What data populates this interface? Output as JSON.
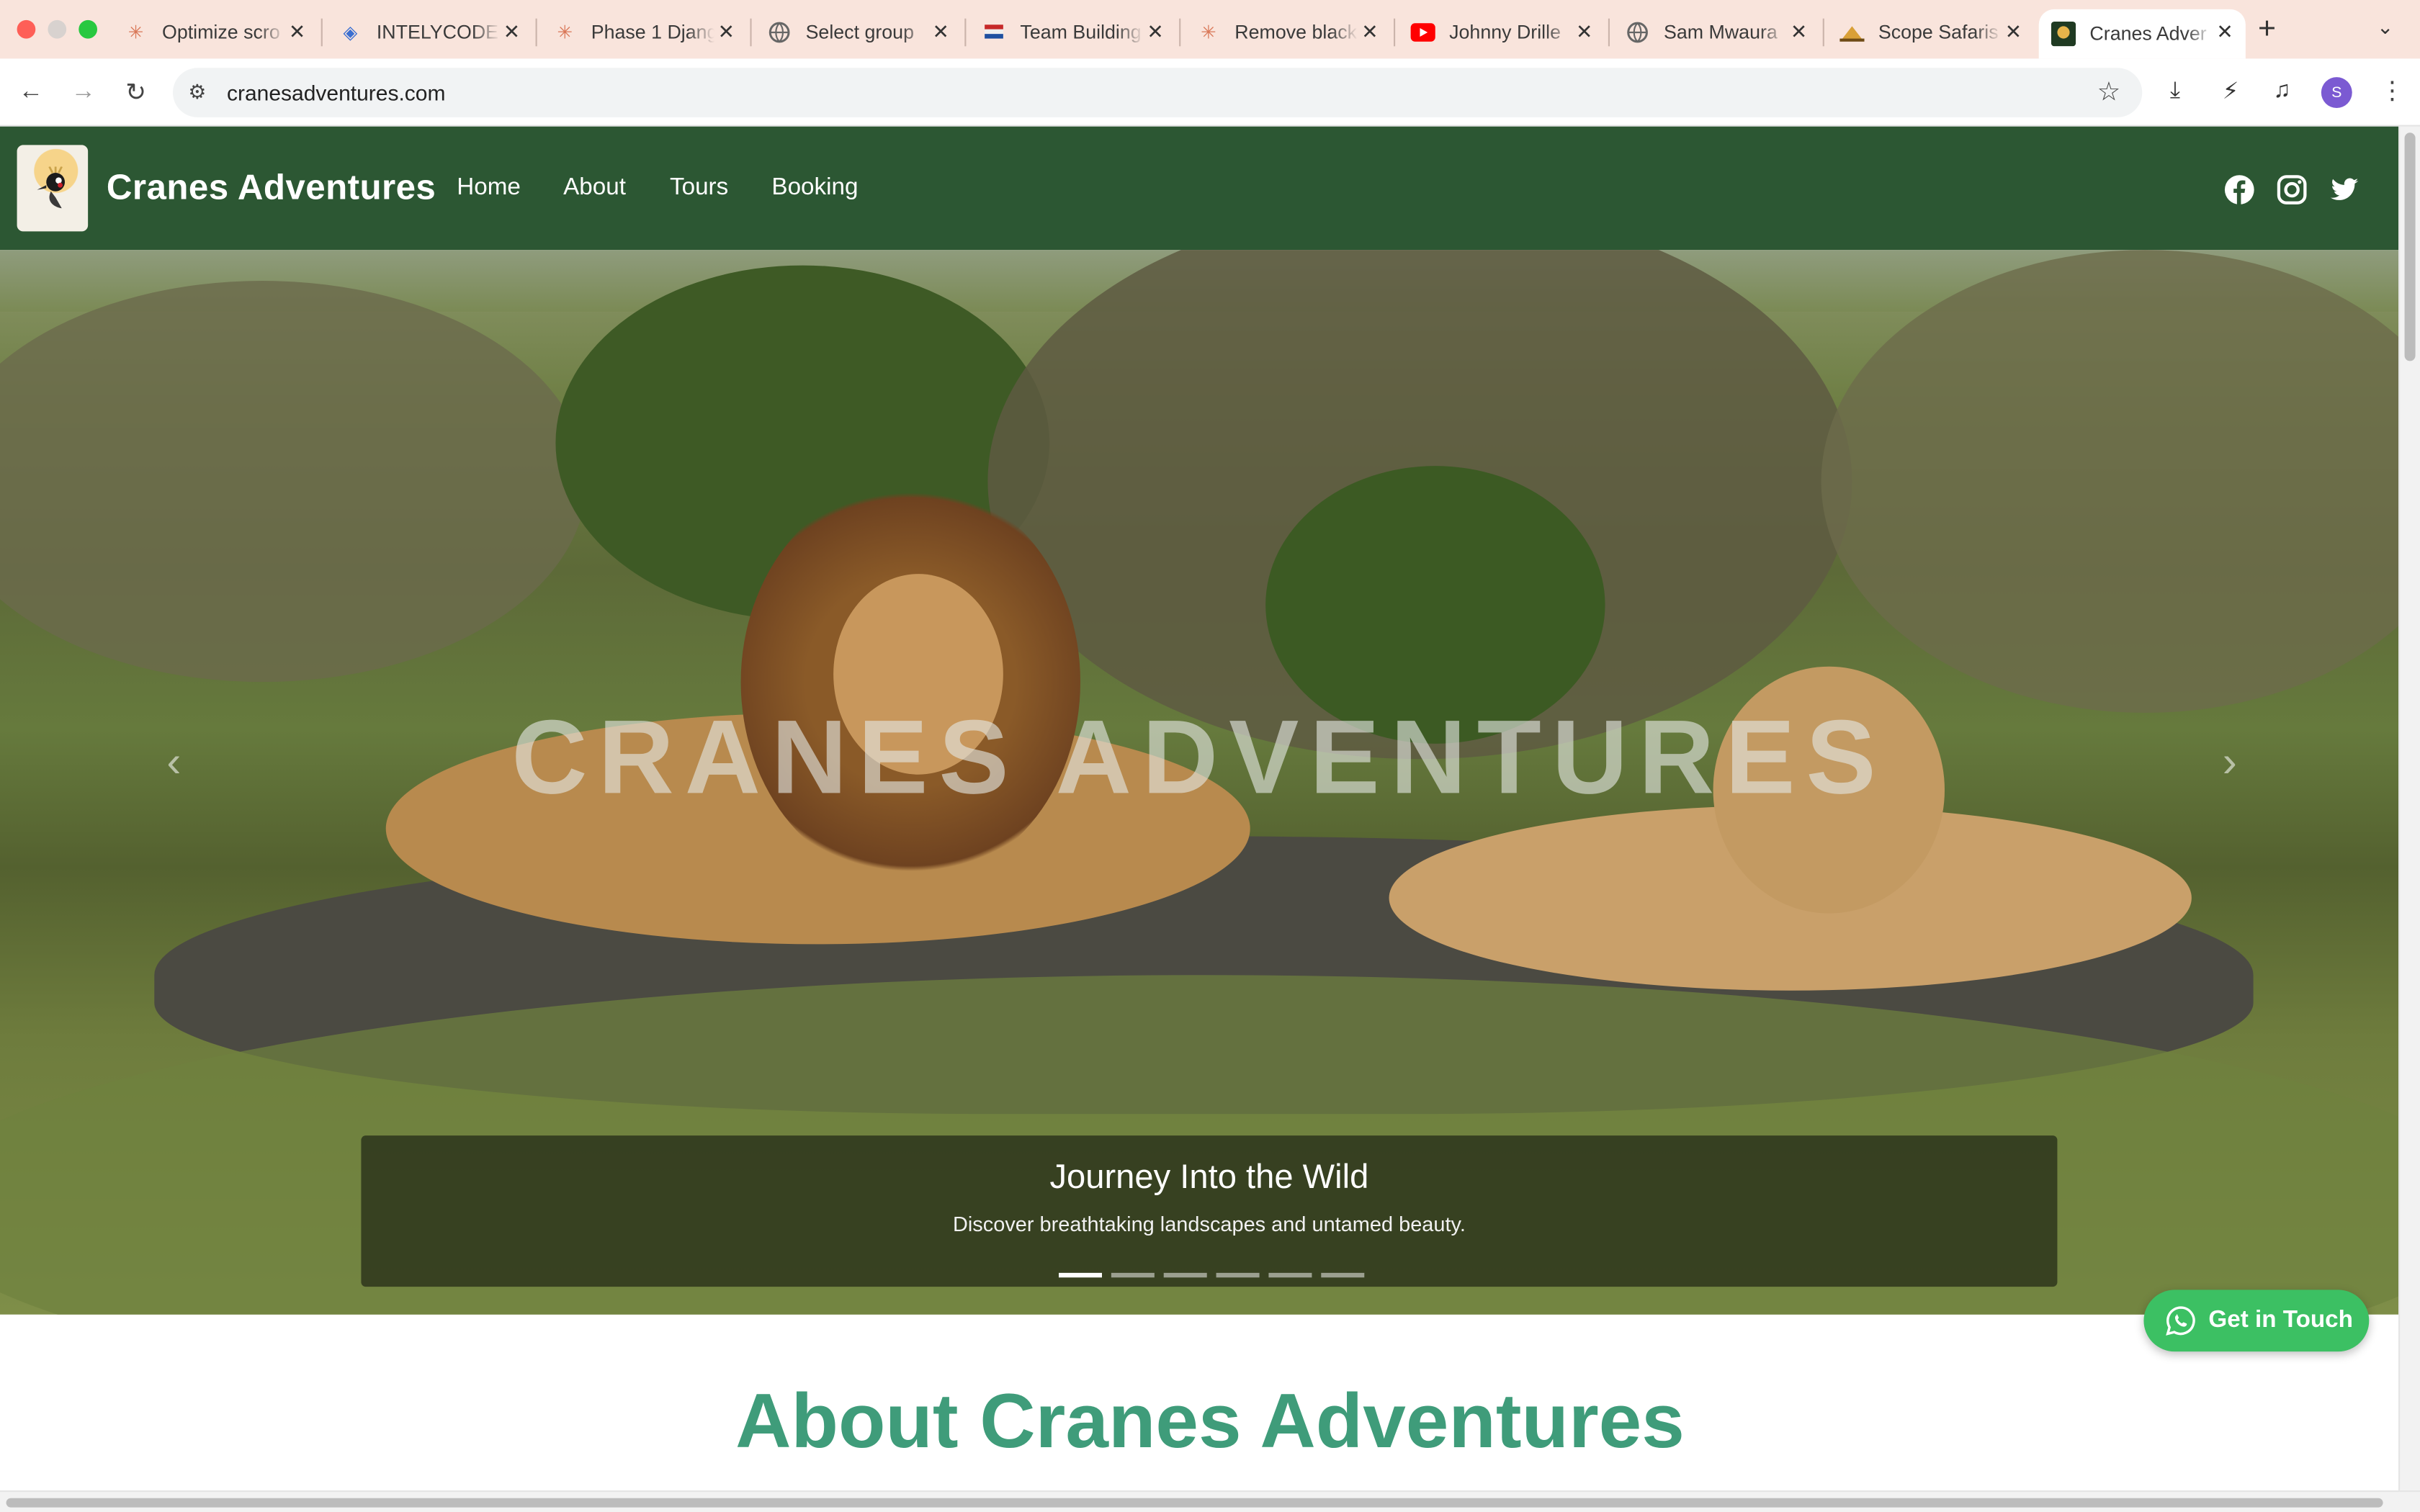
{
  "browser": {
    "tabs": [
      {
        "title": "Optimize scro",
        "icon": "claude-starburst-icon"
      },
      {
        "title": "INTELYCODE",
        "icon": "intelycode-icon"
      },
      {
        "title": "Phase 1 Djang",
        "icon": "claude-starburst-icon"
      },
      {
        "title": "Select group",
        "icon": "globe-icon"
      },
      {
        "title": "Team Building",
        "icon": "flag-icon"
      },
      {
        "title": "Remove black",
        "icon": "claude-starburst-icon"
      },
      {
        "title": "Johnny Drille",
        "icon": "youtube-icon"
      },
      {
        "title": "Sam Mwaura",
        "icon": "globe-icon"
      },
      {
        "title": "Scope Safaris",
        "icon": "safari-logo-icon"
      },
      {
        "title": "Cranes Adver",
        "icon": "cranes-logo-icon",
        "active": true
      }
    ],
    "url": "cranesadventures.com",
    "profile_initial": "S",
    "glyphs": {
      "close": "✕",
      "new_tab": "+",
      "tab_menu": "⌄",
      "back": "←",
      "forward": "→",
      "reload": "↻",
      "site_info": "⚙",
      "star": "☆",
      "download": "⤓",
      "performance": "⚡",
      "media": "♫",
      "kebab": "⋮",
      "prev": "‹",
      "next": "›"
    }
  },
  "site": {
    "brand": "Cranes Adventures",
    "nav": [
      "Home",
      "About",
      "Tours",
      "Booking"
    ],
    "social": [
      "facebook-icon",
      "instagram-icon",
      "twitter-icon"
    ],
    "hero": {
      "title": "CRANES ADVENTURES",
      "caption_title": "Journey Into the Wild",
      "caption_sub": "Discover breathtaking landscapes and untamed beauty.",
      "slides": 6,
      "active_slide": 1
    },
    "about_title": "About Cranes Adventures",
    "cta_label": "Get in Touch"
  },
  "colors": {
    "header_bg": "#2c5733",
    "about_title": "#3f9c7a",
    "cta_bg": "#3cc063",
    "tabbar_bg": "#f9e4dc"
  }
}
